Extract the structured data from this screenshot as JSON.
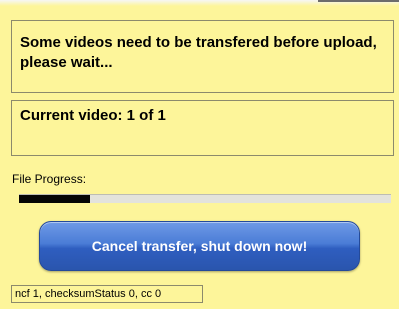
{
  "message": {
    "main": "Some videos need to be transfered before upload, please wait...",
    "current": "Current video: 1 of 1"
  },
  "file_progress": {
    "label": "File Progress:",
    "fraction": 0.19
  },
  "cancel_button": {
    "label": "Cancel transfer, shut down now!"
  },
  "status": {
    "text": "ncf 1, checksumStatus 0, cc 0"
  }
}
